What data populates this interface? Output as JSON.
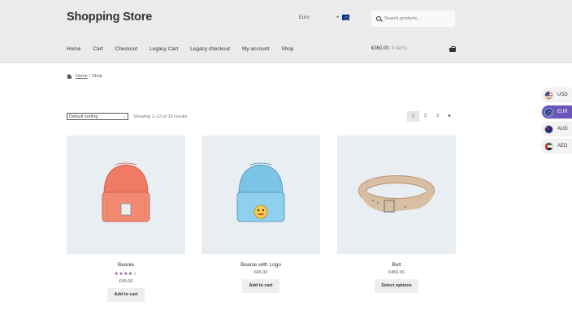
{
  "header": {
    "site_title": "Shopping Store",
    "currency_label": "Euro",
    "search_placeholder": "Search products…",
    "nav": [
      "Home",
      "Cart",
      "Checkout",
      "Legacy Cart",
      "Legacy checkout",
      "My account",
      "Shop"
    ],
    "cart_total": "€360.00",
    "cart_items": "8 items"
  },
  "breadcrumb": {
    "home": "Home",
    "separator": "/",
    "current": "Shop"
  },
  "toolbar": {
    "sorting_value": "Default sorting",
    "result_count": "Showing 1–12 of 33 results",
    "pages": [
      "1",
      "2",
      "3"
    ],
    "next": "▸"
  },
  "products": [
    {
      "name": "Beanie",
      "rating": 4,
      "rating_max": 5,
      "price": "€45.00",
      "button": "Add to cart"
    },
    {
      "name": "Beanie with Logo",
      "price": "€45.00",
      "button": "Add to cart"
    },
    {
      "name": "Belt",
      "price": "€450.00",
      "button": "Select options"
    }
  ],
  "currency_switcher": [
    {
      "code": "USD",
      "flag": "us-flag-icon"
    },
    {
      "code": "EUR",
      "flag": "eu-flag-icon",
      "active": true
    },
    {
      "code": "AUD",
      "flag": "au-flag-icon"
    },
    {
      "code": "AED",
      "flag": "ae-flag-icon"
    }
  ],
  "colors": {
    "accent": "#6b55b9",
    "header_bg": "#ebebeb",
    "star": "#7b4fa3"
  }
}
